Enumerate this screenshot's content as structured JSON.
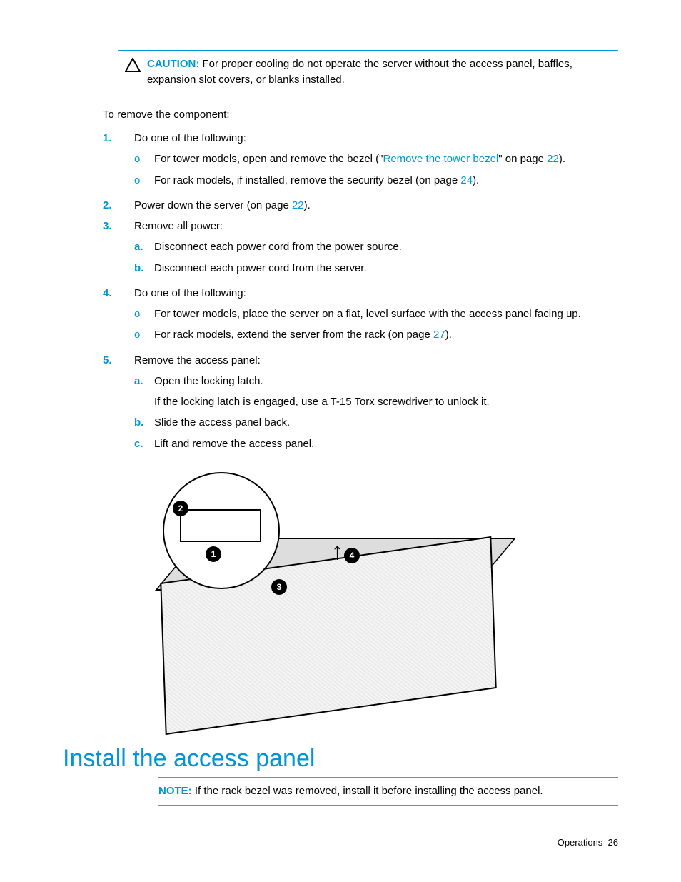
{
  "caution": {
    "label": "CAUTION:",
    "text": " For proper cooling do not operate the server without the access panel, baffles, expansion slot covers, or blanks installed."
  },
  "intro": "To remove the component:",
  "steps": [
    {
      "num": "1.",
      "text": "Do one of the following:",
      "subs": [
        {
          "marker": "o",
          "pre": "For tower models, open and remove the bezel (\"",
          "link": "Remove the tower bezel",
          "mid": "\" on page ",
          "page": "22",
          "post": ")."
        },
        {
          "marker": "o",
          "pre": "For rack models, if installed, remove the security bezel (on page ",
          "page": "24",
          "post": ")."
        }
      ]
    },
    {
      "num": "2.",
      "pre": "Power down the server (on page ",
      "page": "22",
      "post": ")."
    },
    {
      "num": "3.",
      "text": "Remove all power:",
      "subs": [
        {
          "marker": "a.",
          "text": "Disconnect each power cord from the power source."
        },
        {
          "marker": "b.",
          "text": "Disconnect each power cord from the server."
        }
      ]
    },
    {
      "num": "4.",
      "text": "Do one of the following:",
      "subs": [
        {
          "marker": "o",
          "text": "For tower models, place the server on a flat, level surface with the access panel facing up."
        },
        {
          "marker": "o",
          "pre": "For rack models, extend the server from the rack (on page ",
          "page": "27",
          "post": ")."
        }
      ]
    },
    {
      "num": "5.",
      "text": "Remove the access panel:",
      "subs": [
        {
          "marker": "a.",
          "text": "Open the locking latch.",
          "extra": "If the locking latch is engaged, use a T-15 Torx screwdriver to unlock it."
        },
        {
          "marker": "b.",
          "text": "Slide the access panel back."
        },
        {
          "marker": "c.",
          "text": "Lift and remove the access panel."
        }
      ]
    }
  ],
  "annotations": {
    "a1": "1",
    "a2": "2",
    "a3": "3",
    "a4": "4"
  },
  "heading": "Install the access panel",
  "note": {
    "label": "NOTE:",
    "text": " If the rack bezel was removed, install it before installing the access panel."
  },
  "footer": {
    "section": "Operations",
    "page": "26"
  }
}
